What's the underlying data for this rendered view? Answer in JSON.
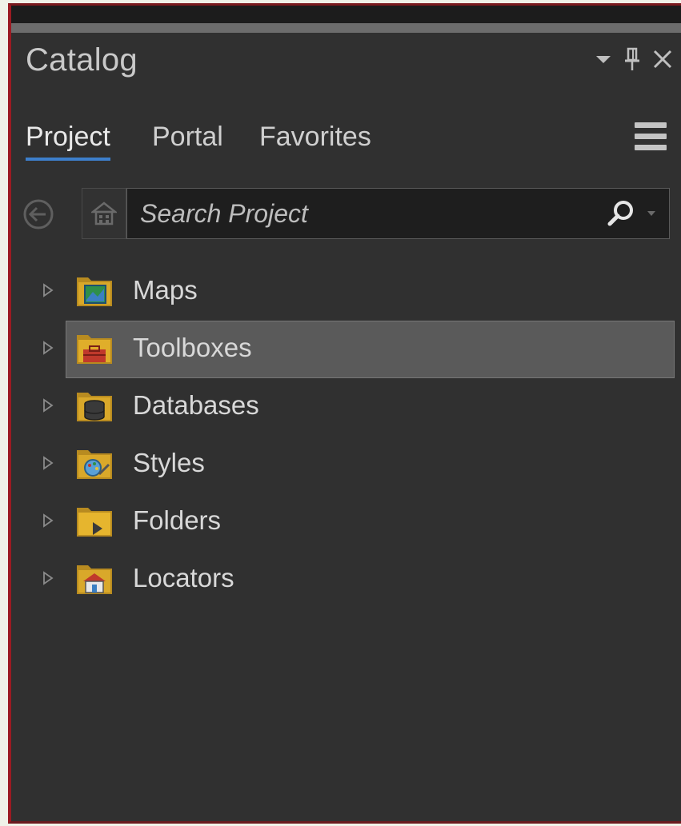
{
  "pane": {
    "title": "Catalog",
    "controls": [
      "dropdown-icon",
      "pin-icon",
      "close-icon"
    ]
  },
  "tabs": [
    {
      "label": "Project",
      "active": true
    },
    {
      "label": "Portal",
      "active": false
    },
    {
      "label": "Favorites",
      "active": false
    }
  ],
  "search": {
    "placeholder": "Search Project",
    "value": ""
  },
  "tree": {
    "items": [
      {
        "label": "Maps",
        "icon": "maps-folder-icon",
        "selected": false
      },
      {
        "label": "Toolboxes",
        "icon": "toolboxes-folder-icon",
        "selected": true
      },
      {
        "label": "Databases",
        "icon": "databases-folder-icon",
        "selected": false
      },
      {
        "label": "Styles",
        "icon": "styles-folder-icon",
        "selected": false
      },
      {
        "label": "Folders",
        "icon": "folders-folder-icon",
        "selected": false
      },
      {
        "label": "Locators",
        "icon": "locators-folder-icon",
        "selected": false
      }
    ]
  },
  "colors": {
    "pane_background": "#303030",
    "active_tab_underline": "#3d7fcc",
    "selection_background": "#5a5a5a",
    "folder_yellow": "#d9a82a",
    "window_border_red": "#9b1b22"
  }
}
